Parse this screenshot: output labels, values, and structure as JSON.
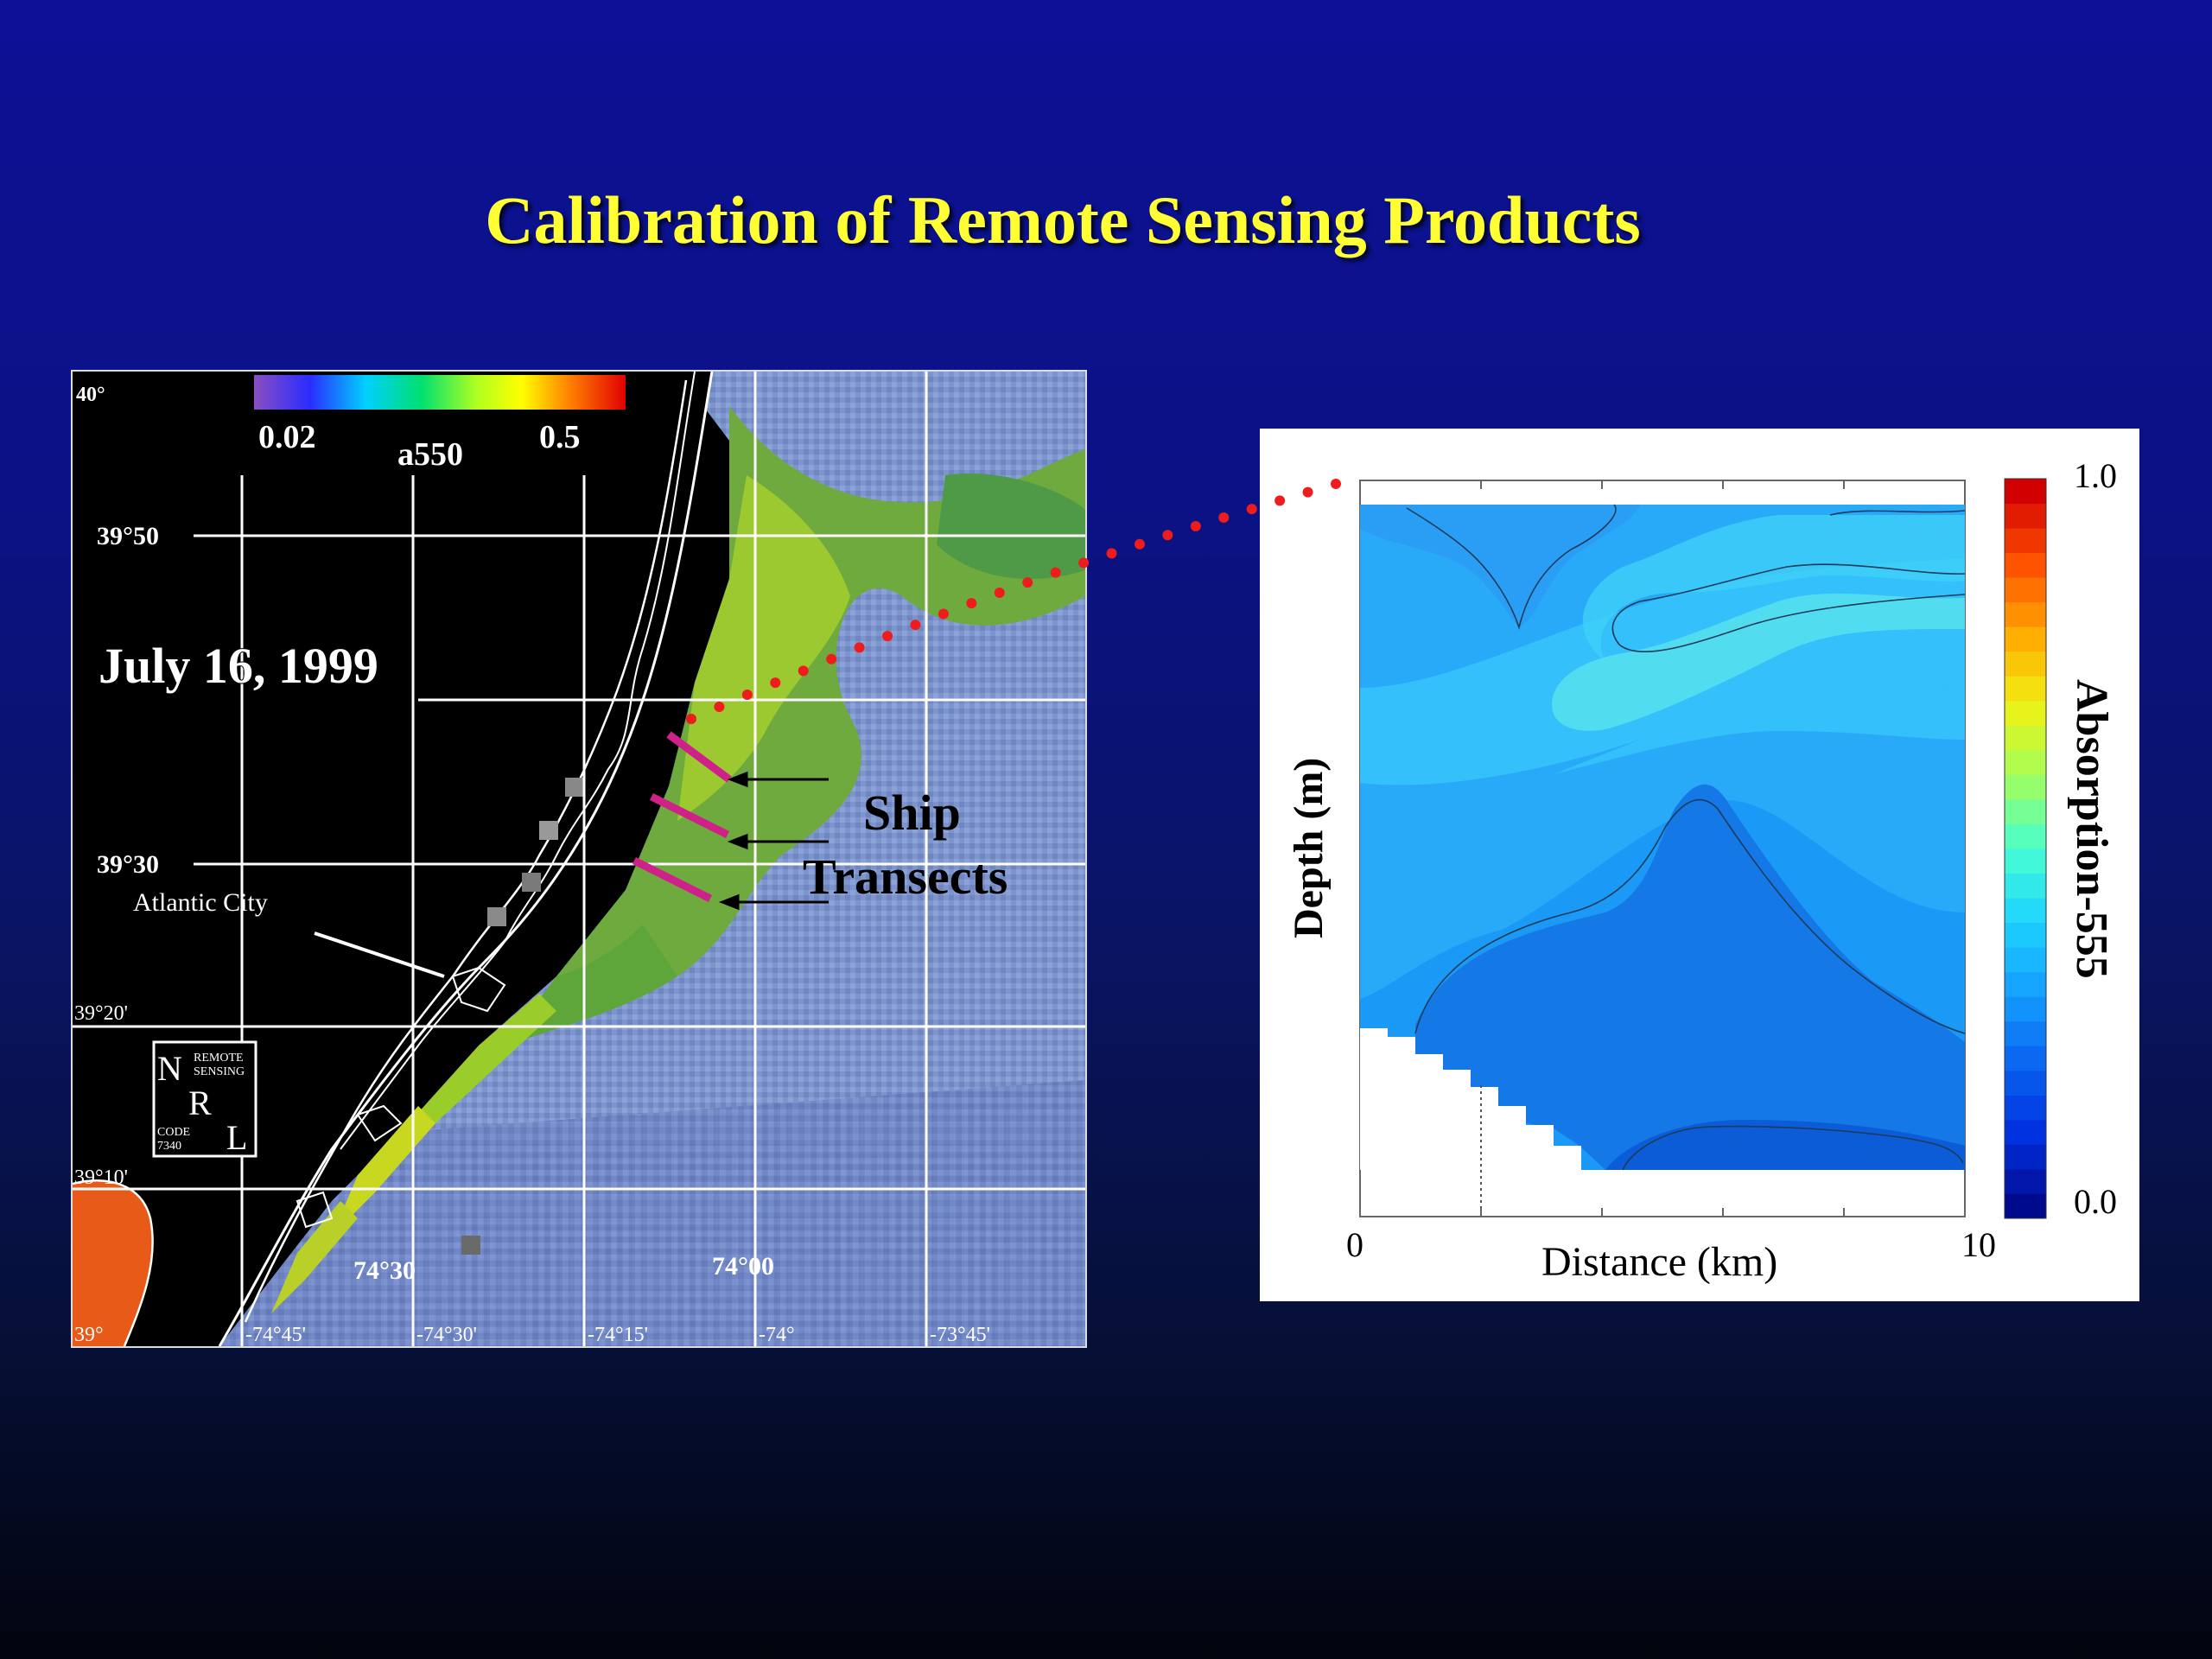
{
  "slide": {
    "title": "Calibration of Remote Sensing Products"
  },
  "map": {
    "date": "July 16, 1999",
    "colorbar": {
      "min_label": "0.02",
      "max_label": "0.5",
      "variable": "a550"
    },
    "lat_labels": [
      "40°",
      "39°50",
      "39°30",
      "39°20'",
      "39°10'",
      "39°"
    ],
    "lon_labels_bottom": [
      "-74°45'",
      "-74°30'",
      "-74°15'",
      "-74°",
      "-73°45'"
    ],
    "lon_labels_inner": [
      "74°30",
      "74°00"
    ],
    "place_label": "Atlantic City",
    "ship_label_1": "Ship",
    "ship_label_2": "Transects",
    "logo": {
      "n": "N",
      "r": "R",
      "l": "L",
      "remote": "REMOTE",
      "sensing": "SENSING",
      "code": "CODE",
      "code_num": "7340"
    },
    "colors": {
      "transect": "#d0208a",
      "grid": "#ffffff",
      "coast": "#ffffff"
    }
  },
  "chart_data": {
    "type": "heatmap",
    "xlabel": "Distance (km)",
    "ylabel": "Depth (m)",
    "x_tick_labels": [
      "0",
      "10"
    ],
    "xlim": [
      0,
      10
    ],
    "colorbar_label": "Absorption-555",
    "colorbar_ticks": [
      "1.0",
      "0.0"
    ],
    "colorbar_range": [
      0.0,
      1.0
    ],
    "colorscale": [
      "#000a8c",
      "#0030e0",
      "#0a64f0",
      "#14a0ff",
      "#1ed4ff",
      "#48ffd2",
      "#a0ff5a",
      "#f0f014",
      "#ffaa00",
      "#ff5000",
      "#d20000"
    ]
  },
  "connector": {
    "color": "#ee1c1c"
  }
}
